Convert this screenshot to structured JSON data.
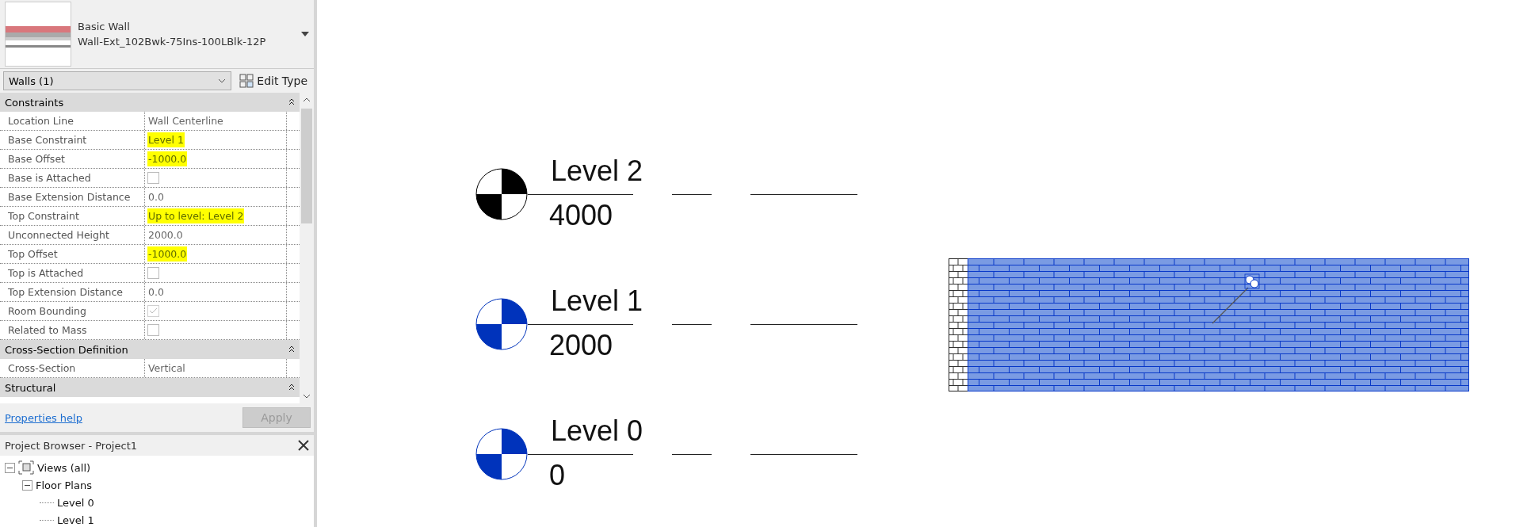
{
  "type_selector": {
    "family": "Basic Wall",
    "type": "Wall-Ext_102Bwk-75Ins-100LBlk-12P"
  },
  "instance_filter": {
    "value": "Walls (1)",
    "edit_type": "Edit Type"
  },
  "groups": [
    {
      "title": "Constraints",
      "expanded": true,
      "rows": [
        {
          "kind": "text",
          "label": "Location Line",
          "value": "Wall Centerline",
          "highlighted": false
        },
        {
          "kind": "text",
          "label": "Base Constraint",
          "value": "Level 1",
          "highlighted": true
        },
        {
          "kind": "text",
          "label": "Base Offset",
          "value": "-1000.0",
          "highlighted": true
        },
        {
          "kind": "checkbox",
          "label": "Base is Attached",
          "checked": false,
          "disabled": false
        },
        {
          "kind": "text",
          "label": "Base Extension Distance",
          "value": "0.0",
          "highlighted": false
        },
        {
          "kind": "text",
          "label": "Top Constraint",
          "value": "Up to level: Level 2",
          "highlighted": true
        },
        {
          "kind": "text",
          "label": "Unconnected Height",
          "value": "2000.0",
          "highlighted": false
        },
        {
          "kind": "text",
          "label": "Top Offset",
          "value": "-1000.0",
          "highlighted": true
        },
        {
          "kind": "checkbox",
          "label": "Top is Attached",
          "checked": false,
          "disabled": false
        },
        {
          "kind": "text",
          "label": "Top Extension Distance",
          "value": "0.0",
          "highlighted": false
        },
        {
          "kind": "checkbox",
          "label": "Room Bounding",
          "checked": true,
          "disabled": true
        },
        {
          "kind": "checkbox",
          "label": "Related to Mass",
          "checked": false,
          "disabled": false
        }
      ]
    },
    {
      "title": "Cross-Section Definition",
      "expanded": true,
      "rows": [
        {
          "kind": "text",
          "label": "Cross-Section",
          "value": "Vertical",
          "highlighted": false
        }
      ]
    },
    {
      "title": "Structural",
      "expanded": true
    }
  ],
  "properties_help": "Properties help",
  "apply": {
    "label": "Apply",
    "disabled": true
  },
  "project_browser": {
    "title": "Project Browser - Project1",
    "tree": [
      {
        "label": "Views (all)",
        "expanded": true,
        "children": [
          {
            "label": "Floor Plans",
            "expanded": true,
            "children": [
              {
                "label": "Level 0"
              },
              {
                "label": "Level 1"
              }
            ]
          }
        ]
      }
    ]
  },
  "levels": [
    {
      "name": "Level 2",
      "elevation": "4000",
      "selected": false
    },
    {
      "name": "Level 1",
      "elevation": "2000",
      "selected": true
    },
    {
      "name": "Level 0",
      "elevation": "0",
      "selected": true
    }
  ],
  "wall": {
    "selected": true
  }
}
